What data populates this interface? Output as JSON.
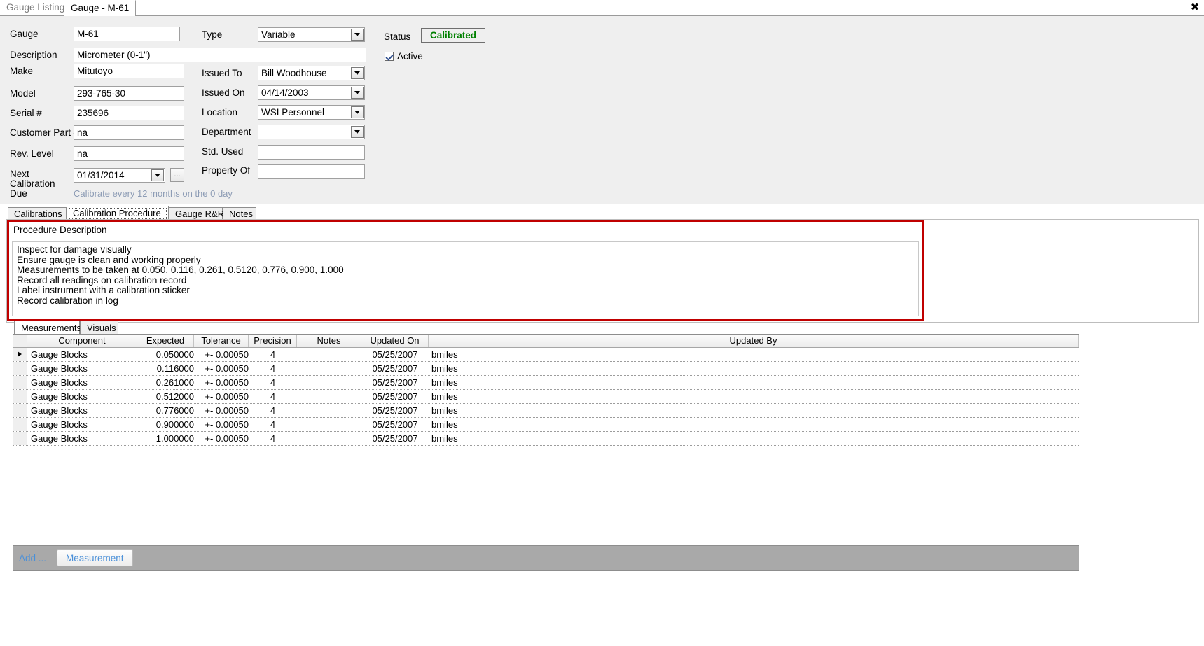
{
  "window": {
    "close_icon": "✖"
  },
  "doc_tabs": [
    {
      "label": "Gauge Listing",
      "active": false
    },
    {
      "label": "Gauge - M-61",
      "active": true
    }
  ],
  "form": {
    "fields": [
      {
        "label": "Gauge",
        "value": "M-61"
      },
      {
        "label": "Description",
        "value": "Micrometer (0-1\")"
      },
      {
        "label": "Make",
        "value": "Mitutoyo"
      },
      {
        "label": "Model",
        "value": "293-765-30"
      },
      {
        "label": "Serial #",
        "value": "235696"
      },
      {
        "label": "Customer Part #",
        "value": "na"
      },
      {
        "label": "Rev. Level",
        "value": "na"
      }
    ],
    "next_cal": {
      "label_line1": "Next",
      "label_line2": "Calibration",
      "label_line3": "Due",
      "value": "01/31/2014",
      "ellipsis_label": "...",
      "hint": "Calibrate every 12 months on the 0 day"
    },
    "right_fields": [
      {
        "label": "Type",
        "value": "Variable",
        "kind": "combo"
      },
      {
        "label": "Issued To",
        "value": "Bill Woodhouse",
        "kind": "combo"
      },
      {
        "label": "Issued On",
        "value": "04/14/2003",
        "kind": "combo"
      },
      {
        "label": "Location",
        "value": "WSI Personnel",
        "kind": "combo"
      },
      {
        "label": "Department",
        "value": "",
        "kind": "combo"
      },
      {
        "label": "Std. Used",
        "value": "",
        "kind": "text"
      },
      {
        "label": "Property Of",
        "value": "",
        "kind": "text"
      }
    ],
    "status": {
      "label": "Status",
      "value": "Calibrated",
      "color": "#008000"
    },
    "active_checkbox": {
      "label": "Active",
      "checked": true
    }
  },
  "inner_tabs": [
    {
      "label": "Calibrations",
      "selected": false
    },
    {
      "label": "Calibration Procedure",
      "selected": true
    },
    {
      "label": "Gauge R&R",
      "selected": false
    },
    {
      "label": "Notes",
      "selected": false
    }
  ],
  "procedure": {
    "title": "Procedure Description",
    "text": "Inspect for damage visually\nEnsure gauge is clean and working properly\nMeasurements to be taken at 0.050. 0.116, 0.261, 0.5120, 0.776, 0.900, 1.000\nRecord all readings on calibration record\nLabel instrument with a calibration sticker\nRecord calibration in log",
    "highlight_color": "#c00000"
  },
  "measurement_tabs": [
    {
      "label": "Measurements",
      "selected": true
    },
    {
      "label": "Visuals",
      "selected": false
    }
  ],
  "grid": {
    "columns": [
      "Component",
      "Expected",
      "Tolerance",
      "Precision",
      "Notes",
      "Updated On",
      "Updated By"
    ],
    "rows": [
      {
        "selected": true,
        "component": "Gauge Blocks",
        "expected": "0.050000",
        "tolerance": "+- 0.00050",
        "precision": "4",
        "notes": "",
        "updated_on": "05/25/2007",
        "updated_by": "bmiles"
      },
      {
        "selected": false,
        "component": "Gauge Blocks",
        "expected": "0.116000",
        "tolerance": "+- 0.00050",
        "precision": "4",
        "notes": "",
        "updated_on": "05/25/2007",
        "updated_by": "bmiles"
      },
      {
        "selected": false,
        "component": "Gauge Blocks",
        "expected": "0.261000",
        "tolerance": "+- 0.00050",
        "precision": "4",
        "notes": "",
        "updated_on": "05/25/2007",
        "updated_by": "bmiles"
      },
      {
        "selected": false,
        "component": "Gauge Blocks",
        "expected": "0.512000",
        "tolerance": "+- 0.00050",
        "precision": "4",
        "notes": "",
        "updated_on": "05/25/2007",
        "updated_by": "bmiles"
      },
      {
        "selected": false,
        "component": "Gauge Blocks",
        "expected": "0.776000",
        "tolerance": "+- 0.00050",
        "precision": "4",
        "notes": "",
        "updated_on": "05/25/2007",
        "updated_by": "bmiles"
      },
      {
        "selected": false,
        "component": "Gauge Blocks",
        "expected": "0.900000",
        "tolerance": "+- 0.00050",
        "precision": "4",
        "notes": "",
        "updated_on": "05/25/2007",
        "updated_by": "bmiles"
      },
      {
        "selected": false,
        "component": "Gauge Blocks",
        "expected": "1.000000",
        "tolerance": "+- 0.00050",
        "precision": "4",
        "notes": "",
        "updated_on": "05/25/2007",
        "updated_by": "bmiles"
      }
    ]
  },
  "footer": {
    "add_label": "Add ...",
    "measurement_button": "Measurement"
  }
}
